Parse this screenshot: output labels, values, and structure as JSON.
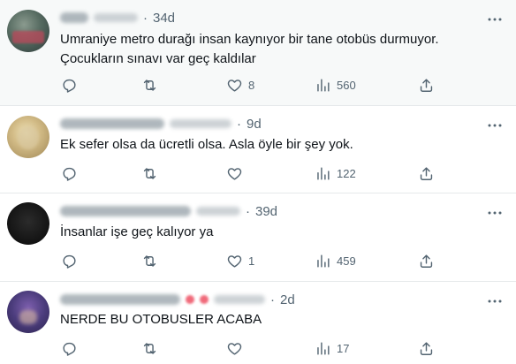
{
  "tweets": [
    {
      "time": "34d",
      "text_lines": [
        "Umraniye metro durağı insan kaynıyor bir tane otobüs durmuyor.",
        "Çocukların sınavı var geç kaldılar"
      ],
      "likes": "8",
      "views": "560"
    },
    {
      "time": "9d",
      "text_lines": [
        "Ek sefer olsa da ücretli olsa. Asla öyle bir şey yok."
      ],
      "likes": "",
      "views": "122"
    },
    {
      "time": "39d",
      "text_lines": [
        "İnsanlar işe geç kalıyor ya"
      ],
      "likes": "1",
      "views": "459"
    },
    {
      "time": "2d",
      "text_lines": [
        "NERDE BU OTOBUSLER ACABA"
      ],
      "likes": "",
      "views": "17"
    }
  ],
  "icons": {
    "reply": "reply-icon",
    "retweet": "retweet-icon",
    "like": "heart-icon",
    "views": "views-icon",
    "share": "share-icon",
    "more": "more-icon"
  },
  "colors": {
    "text": "#0f1419",
    "muted": "#536471",
    "highlight_bg": "#f7f9f9",
    "divider": "#e6e9eb"
  }
}
